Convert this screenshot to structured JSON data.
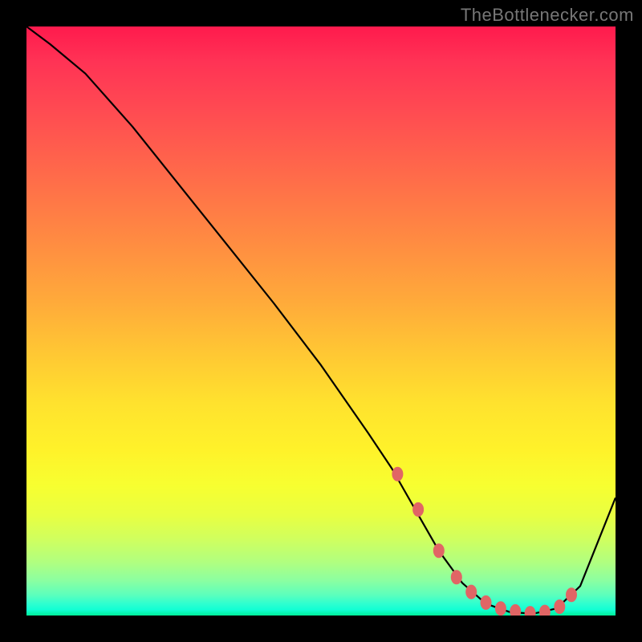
{
  "watermark": "TheBottlenecker.com",
  "colors": {
    "frame": "#000000",
    "curve": "#000000",
    "marker": "#e16565",
    "gradient_top": "#ff1a4d",
    "gradient_bottom": "#00ef99"
  },
  "chart_data": {
    "type": "line",
    "title": "",
    "xlabel": "",
    "ylabel": "",
    "xlim": [
      0,
      100
    ],
    "ylim": [
      0,
      100
    ],
    "x": [
      0,
      4,
      10,
      18,
      26,
      34,
      42,
      50,
      58,
      62,
      66,
      70,
      74,
      78,
      82,
      86,
      90,
      94,
      100
    ],
    "values": [
      100,
      97,
      92,
      83,
      73,
      63,
      53,
      42.5,
      31,
      25,
      18,
      11,
      5.5,
      2,
      0.6,
      0.3,
      1.2,
      5,
      20
    ],
    "markers_x": [
      63,
      66.5,
      70,
      73,
      75.5,
      78,
      80.5,
      83,
      85.5,
      88,
      90.5,
      92.5
    ],
    "markers_y": [
      24,
      18,
      11,
      6.5,
      4,
      2.2,
      1.2,
      0.7,
      0.4,
      0.6,
      1.5,
      3.5
    ]
  }
}
